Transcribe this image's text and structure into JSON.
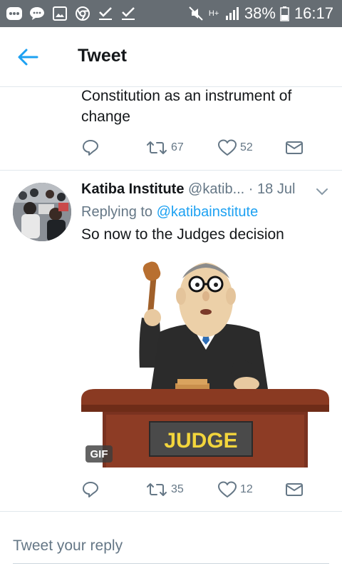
{
  "status_bar": {
    "battery_percent": "38%",
    "time": "16:17",
    "network": "H+",
    "icons": [
      "more-icon",
      "message-icon",
      "image-icon",
      "chrome-icon",
      "check-icon",
      "check-icon",
      "mute-icon",
      "signal-icon",
      "battery-icon"
    ]
  },
  "header": {
    "title": "Tweet"
  },
  "partial_tweet": {
    "text_line_1": "Constitution as an instrument of",
    "text_line_2": "change",
    "retweets": "67",
    "likes": "52"
  },
  "tweet": {
    "name": "Katiba Institute",
    "handle": "@katib...",
    "separator": "·",
    "date": "18 Jul",
    "replying_prefix": "Replying to",
    "replying_handle": "@katibainstitute",
    "text": "So now to the Judges decision",
    "media_caption": "JUDGE",
    "gif_badge": "GIF",
    "retweets": "35",
    "likes": "12"
  },
  "reply": {
    "placeholder": "Tweet your reply"
  },
  "colors": {
    "accent": "#1da1f2",
    "muted": "#657786",
    "status_bar": "#666d73"
  }
}
